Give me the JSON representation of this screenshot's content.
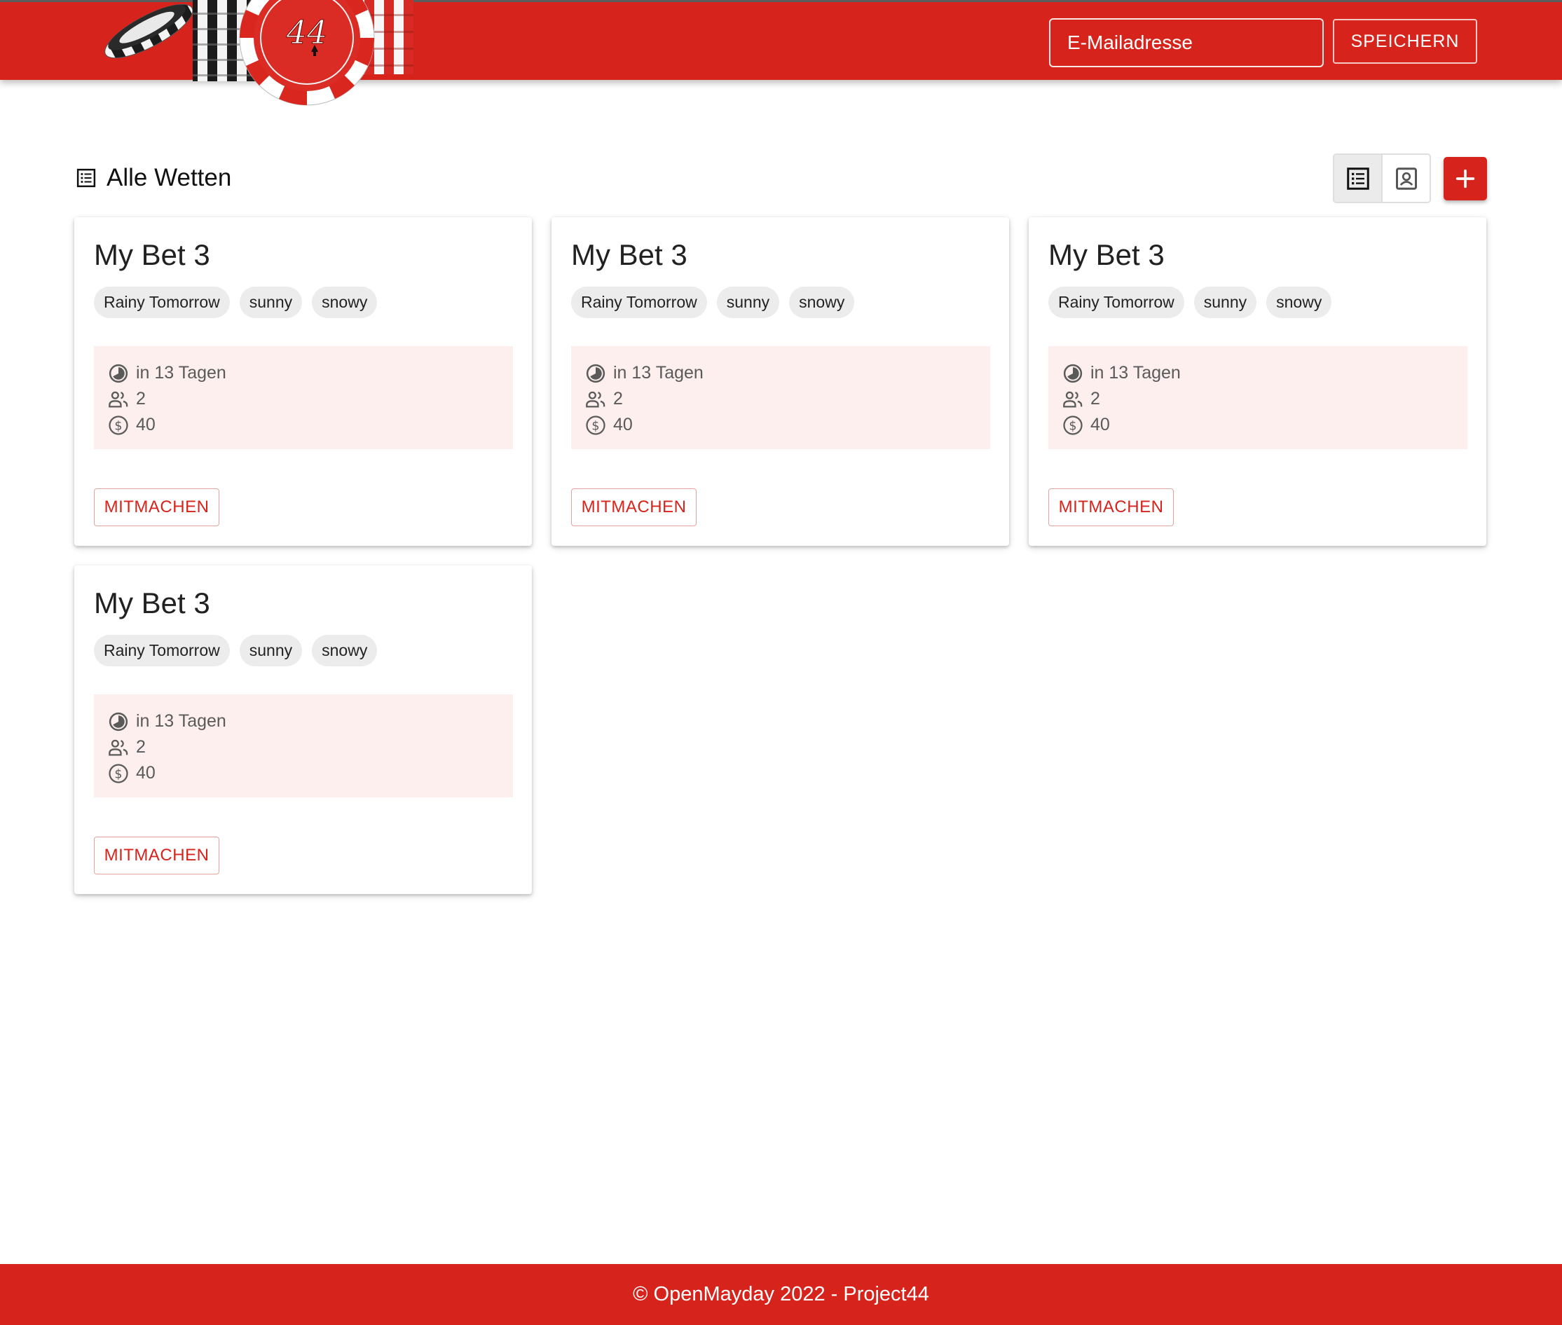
{
  "header": {
    "email_placeholder": "E-Mailadresse",
    "save_label": "SPEICHERN",
    "logo_chip_text": "44"
  },
  "toolbar": {
    "title": "Alle Wetten",
    "view_list_icon": "list-view-icon",
    "view_card_icon": "card-view-icon",
    "add_icon": "plus-icon"
  },
  "bets": [
    {
      "title": "My Bet 3",
      "tags": [
        "Rainy Tomorrow",
        "sunny",
        "snowy"
      ],
      "due": "in 13 Tagen",
      "participants": "2",
      "stake": "40",
      "join_label": "MITMACHEN"
    },
    {
      "title": "My Bet 3",
      "tags": [
        "Rainy Tomorrow",
        "sunny",
        "snowy"
      ],
      "due": "in 13 Tagen",
      "participants": "2",
      "stake": "40",
      "join_label": "MITMACHEN"
    },
    {
      "title": "My Bet 3",
      "tags": [
        "Rainy Tomorrow",
        "sunny",
        "snowy"
      ],
      "due": "in 13 Tagen",
      "participants": "2",
      "stake": "40",
      "join_label": "MITMACHEN"
    },
    {
      "title": "My Bet 3",
      "tags": [
        "Rainy Tomorrow",
        "sunny",
        "snowy"
      ],
      "due": "in 13 Tagen",
      "participants": "2",
      "stake": "40",
      "join_label": "MITMACHEN"
    }
  ],
  "footer": {
    "text": "© OpenMayday 2022 - Project44"
  },
  "colors": {
    "brand_red": "#d6241d",
    "info_background": "#fcefee",
    "chip_background": "#ececec"
  }
}
